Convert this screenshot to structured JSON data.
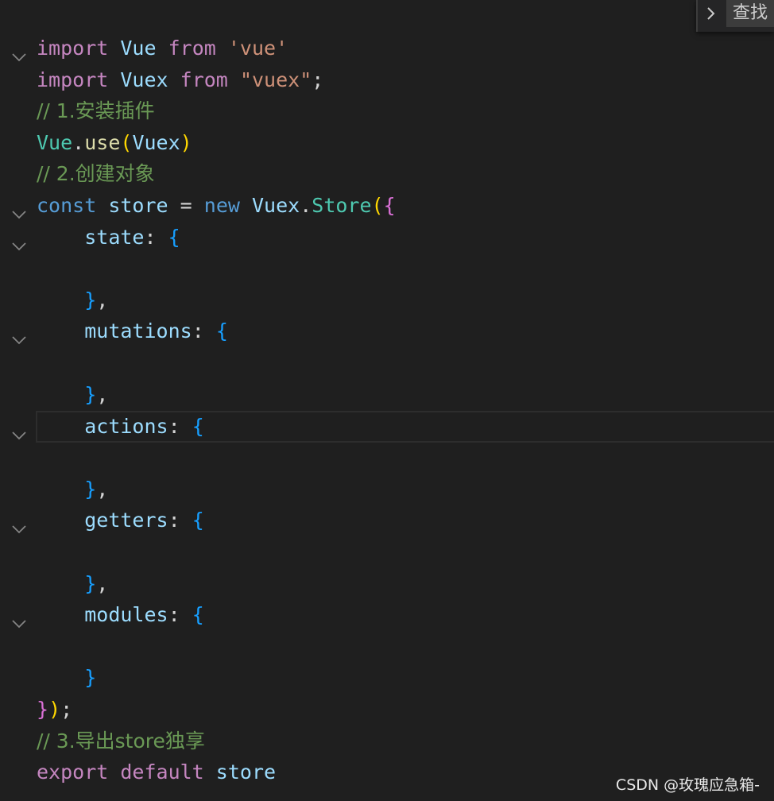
{
  "find_widget": {
    "placeholder": "查找"
  },
  "code": {
    "l1": {
      "kw": "import",
      "name": "Vue",
      "from": "from",
      "str": "'vue'"
    },
    "l2": {
      "kw": "import",
      "name": "Vuex",
      "from": "from",
      "str": "\"vuex\"",
      "semi": ";"
    },
    "l3": {
      "comment": "// 1.安装插件"
    },
    "l4": {
      "obj": "Vue",
      "dot": ".",
      "fn": "use",
      "open": "(",
      "arg": "Vuex",
      "close": ")"
    },
    "l5": {
      "comment": "// 2.创建对象"
    },
    "l6": {
      "kw": "const",
      "name": "store",
      "eq": "=",
      "new": "new",
      "obj": "Vuex",
      "dot": ".",
      "cls": "Store",
      "paren": "(",
      "brace": "{"
    },
    "l7": {
      "prop": "state",
      "colon": ":",
      "brace": "{"
    },
    "l9": {
      "close": "}",
      "comma": ","
    },
    "l10": {
      "prop": "mutations",
      "colon": ":",
      "brace": "{"
    },
    "l12": {
      "close": "}",
      "comma": ","
    },
    "l13": {
      "prop": "actions",
      "colon": ":",
      "brace": "{"
    },
    "l15": {
      "close": "}",
      "comma": ","
    },
    "l16": {
      "prop": "getters",
      "colon": ":",
      "brace": "{"
    },
    "l18": {
      "close": "}",
      "comma": ","
    },
    "l19": {
      "prop": "modules",
      "colon": ":",
      "brace": "{"
    },
    "l21": {
      "close": "}"
    },
    "l22": {
      "brace": "}",
      "paren": ")",
      "semi": ";"
    },
    "l23": {
      "comment": "// 3.导出store独享"
    },
    "l24": {
      "kw": "export",
      "kw2": "default",
      "name": "store"
    }
  },
  "watermark": "CSDN @玫瑰应急箱-",
  "colors": {
    "background": "#1f1f1f",
    "keyword_purple": "#c586c0",
    "keyword_blue": "#569cd6",
    "variable": "#9cdcfe",
    "class": "#4ec9b0",
    "function": "#dcdcaa",
    "string": "#ce9178",
    "comment": "#6a9955"
  },
  "icons": {
    "fold": "chevron-down-icon",
    "find_toggle": "chevron-right-icon"
  }
}
